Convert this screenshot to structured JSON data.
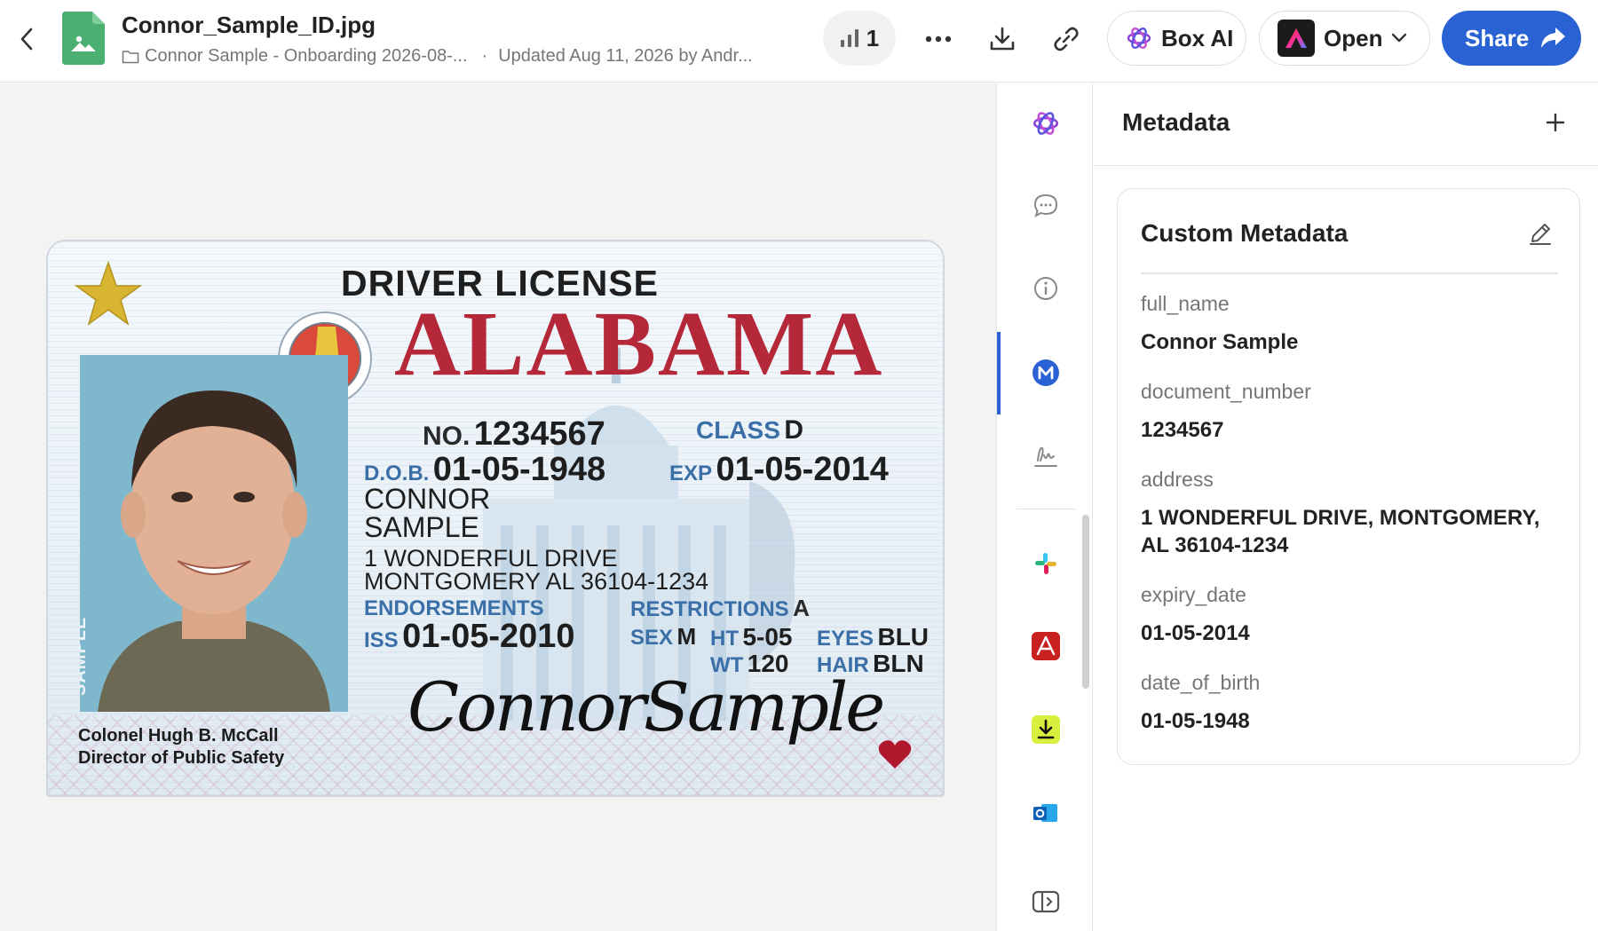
{
  "header": {
    "file_name": "Connor_Sample_ID.jpg",
    "folder_path": "Connor Sample - Onboarding 2026-08-...",
    "updated_text": "Updated Aug 11, 2026 by Andr...",
    "views_count": "1",
    "box_ai_label": "Box AI",
    "open_label": "Open",
    "share_label": "Share",
    "icons": [
      "back-arrow-icon",
      "image-file-icon",
      "folder-icon",
      "bar-chart-icon",
      "more-icon",
      "download-icon",
      "link-icon",
      "box-ai-icon",
      "acrobat-icon",
      "chevron-down-icon",
      "share-arrow-icon"
    ]
  },
  "id_card": {
    "title": "DRIVER LICENSE",
    "state": "ALABAMA",
    "no_label": "NO.",
    "no_value": "1234567",
    "class_label": "CLASS",
    "class_value": "D",
    "dob_label": "D.O.B.",
    "dob_value": "01-05-1948",
    "exp_label": "EXP",
    "exp_value": "01-05-2014",
    "first_name": "CONNOR",
    "last_name": "SAMPLE",
    "address_line1": "1 WONDERFUL DRIVE",
    "address_line2": "MONTGOMERY AL 36104-1234",
    "endorsements_label": "ENDORSEMENTS",
    "restrictions_label": "RESTRICTIONS",
    "restrictions_value": "A",
    "iss_label": "ISS",
    "iss_value": "01-05-2010",
    "sex_label": "SEX",
    "sex_value": "M",
    "ht_label": "HT",
    "ht_value": "5-05",
    "wt_label": "WT",
    "wt_value": "120",
    "eyes_label": "EYES",
    "eyes_value": "BLU",
    "hair_label": "HAIR",
    "hair_value": "BLN",
    "photo_tag": "SAMPLE",
    "director_line1": "Colonel Hugh B. McCall",
    "director_line2": "Director of Public Safety",
    "signature": "ConnorSample",
    "colors": {
      "state": "#b4283a",
      "star": "#d8b531",
      "heart": "#b0182d",
      "photo_bg": "#7fb8cd"
    }
  },
  "rail": {
    "items": [
      "box-ai-icon",
      "comment-icon",
      "info-icon",
      "metadata-icon",
      "sign-icon",
      "slack-icon",
      "acrobat-icon",
      "download-app-icon",
      "outlook-icon",
      "collapse-panel-icon"
    ],
    "active": "metadata-icon"
  },
  "panel": {
    "title": "Metadata",
    "card_title": "Custom Metadata",
    "fields": [
      {
        "key": "full_name",
        "value": "Connor Sample"
      },
      {
        "key": "document_number",
        "value": "1234567"
      },
      {
        "key": "address",
        "value": "1 WONDERFUL DRIVE, MONTGOMERY, AL 36104-1234"
      },
      {
        "key": "expiry_date",
        "value": "01-05-2014"
      },
      {
        "key": "date_of_birth",
        "value": "01-05-1948"
      }
    ]
  },
  "colors": {
    "accent": "#2a62d4",
    "file_icon": "#4caf72",
    "box_ai": "#8b3fd9"
  }
}
